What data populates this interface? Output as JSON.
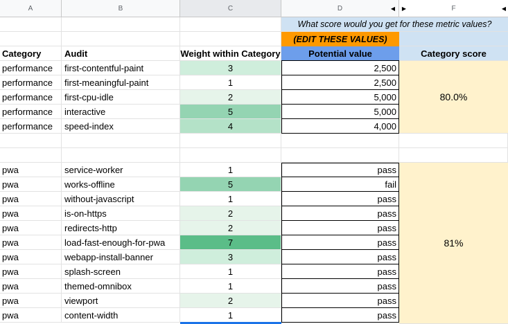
{
  "columns": [
    "A",
    "B",
    "C",
    "D",
    "F"
  ],
  "header_row": {
    "question": "What score would you get for these metric values?",
    "edit_hint": "(EDIT THESE VALUES)",
    "category": "Category",
    "audit": "Audit",
    "weight": "Weight within Category",
    "potential": "Potential value",
    "score": "Category score"
  },
  "performance": {
    "score": "80.0%",
    "rows": [
      {
        "category": "performance",
        "audit": "first-contentful-paint",
        "weight": "3",
        "value": "2,500"
      },
      {
        "category": "performance",
        "audit": "first-meaningful-paint",
        "weight": "1",
        "value": "2,500"
      },
      {
        "category": "performance",
        "audit": "first-cpu-idle",
        "weight": "2",
        "value": "5,000"
      },
      {
        "category": "performance",
        "audit": "interactive",
        "weight": "5",
        "value": "5,000"
      },
      {
        "category": "performance",
        "audit": "speed-index",
        "weight": "4",
        "value": "4,000"
      }
    ]
  },
  "pwa": {
    "score": "81%",
    "rows": [
      {
        "category": "pwa",
        "audit": "service-worker",
        "weight": "1",
        "value": "pass"
      },
      {
        "category": "pwa",
        "audit": "works-offline",
        "weight": "5",
        "value": "fail"
      },
      {
        "category": "pwa",
        "audit": "without-javascript",
        "weight": "1",
        "value": "pass"
      },
      {
        "category": "pwa",
        "audit": "is-on-https",
        "weight": "2",
        "value": "pass"
      },
      {
        "category": "pwa",
        "audit": "redirects-http",
        "weight": "2",
        "value": "pass"
      },
      {
        "category": "pwa",
        "audit": "load-fast-enough-for-pwa",
        "weight": "7",
        "value": "pass"
      },
      {
        "category": "pwa",
        "audit": "webapp-install-banner",
        "weight": "3",
        "value": "pass"
      },
      {
        "category": "pwa",
        "audit": "splash-screen",
        "weight": "1",
        "value": "pass"
      },
      {
        "category": "pwa",
        "audit": "themed-omnibox",
        "weight": "1",
        "value": "pass"
      },
      {
        "category": "pwa",
        "audit": "viewport",
        "weight": "2",
        "value": "pass"
      },
      {
        "category": "pwa",
        "audit": "content-width",
        "weight": "1",
        "value": "pass"
      }
    ]
  },
  "colors": {
    "header_question_bg": "#cfe2f3",
    "edit_hint_bg": "#ff9900",
    "potential_header_bg": "#6d9eeb",
    "score_bg": "#fff2cc",
    "selection_underline": "#1a73e8"
  }
}
